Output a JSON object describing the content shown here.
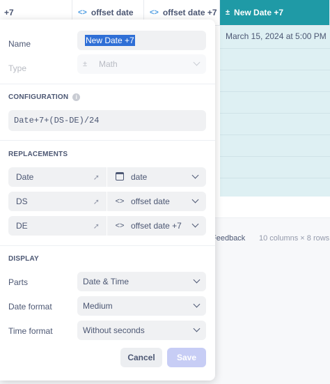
{
  "table": {
    "headers": [
      {
        "label": "+7",
        "code_icon": ""
      },
      {
        "label": "offset date",
        "code_icon": "<>"
      },
      {
        "label": "offset date +7",
        "code_icon": "<>"
      },
      {
        "label": "New Date +7",
        "code_icon": "math-icon"
      }
    ],
    "active_cell_value": "March 15, 2024 at 5:00 PM",
    "footer_feedback": "Feedback",
    "footer_count": "10 columns × 8 rows",
    "accent_color": "#1f9aa6"
  },
  "popover": {
    "name_label": "Name",
    "name_value": "New Date +7",
    "type_label": "Type",
    "type_value": "Math",
    "configuration_header": "CONFIGURATION",
    "formula": "Date+7+(DS-DE)/24",
    "replacements_header": "REPLACEMENTS",
    "replacements": [
      {
        "from": "Date",
        "to": "date",
        "icon": "calendar-icon"
      },
      {
        "from": "DS",
        "to": "offset date",
        "icon": "code-icon"
      },
      {
        "from": "DE",
        "to": "offset date +7",
        "icon": "code-icon"
      }
    ],
    "display_header": "DISPLAY",
    "parts_label": "Parts",
    "parts_value": "Date & Time",
    "date_format_label": "Date format",
    "date_format_value": "Medium",
    "time_format_label": "Time format",
    "time_format_value": "Without seconds",
    "cancel_label": "Cancel",
    "save_label": "Save",
    "save_color": "#c7cdf5"
  }
}
